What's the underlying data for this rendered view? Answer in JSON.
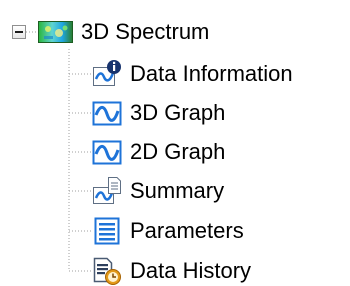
{
  "tree": {
    "root": {
      "label": "3D Spectrum",
      "icon": "spectrum-icon",
      "expanded": true
    },
    "children": [
      {
        "label": "Data Information",
        "icon": "data-information-icon"
      },
      {
        "label": "3D Graph",
        "icon": "graph-3d-icon"
      },
      {
        "label": "2D Graph",
        "icon": "graph-2d-icon"
      },
      {
        "label": "Summary",
        "icon": "summary-icon"
      },
      {
        "label": "Parameters",
        "icon": "parameters-icon"
      },
      {
        "label": "Data History",
        "icon": "data-history-icon"
      }
    ]
  },
  "colors": {
    "wave_blue": "#1e73d8",
    "info_badge": "#17336e",
    "history_clock": "#e39a19",
    "tree_lines": "#9f9f9f"
  }
}
